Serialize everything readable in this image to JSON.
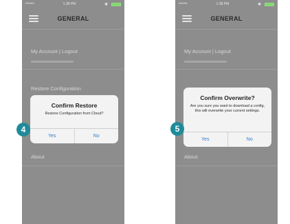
{
  "colors": {
    "phone_background": "#8d8d8d",
    "dialog_background": "#f3f3f3",
    "dialog_button": "#2d7ccf",
    "badge": "#1f8b9a",
    "battery": "#7ed66a"
  },
  "screens": [
    {
      "step": "4",
      "status": {
        "signal": "•••••",
        "time": "1:38 PM",
        "bluetooth": "✱"
      },
      "nav_title": "GENERAL",
      "menu": {
        "account": "My Account | Logout",
        "restore": "Restore Configuration",
        "about": "About"
      },
      "dialog": {
        "title": "Confirm Restore",
        "message": "Restore Configuration from Cloud?",
        "yes": "Yes",
        "no": "No"
      }
    },
    {
      "step": "5",
      "status": {
        "signal": "•••••",
        "time": "1:38 PM",
        "bluetooth": "✱"
      },
      "nav_title": "GENERAL",
      "menu": {
        "account": "My Account | Logout",
        "about": "About"
      },
      "dialog": {
        "title": "Confirm Overwrite?",
        "message": "Are you sure you want to download a config, this will overwrite your current settings.",
        "yes": "Yes",
        "no": "No"
      }
    }
  ]
}
